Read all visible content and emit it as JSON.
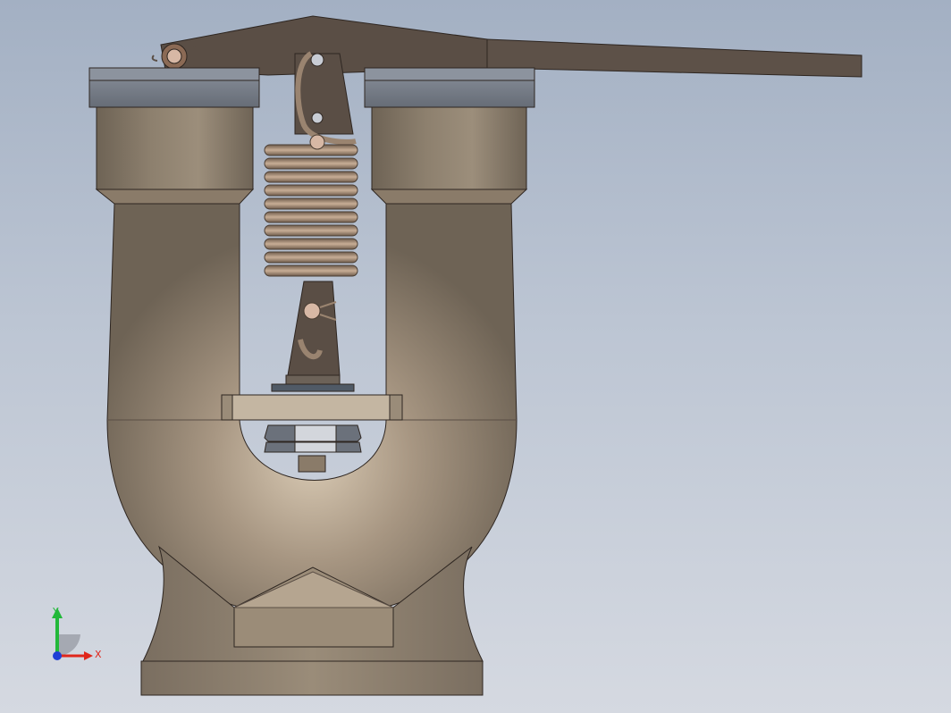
{
  "viewport": {
    "background_top": "#a3b0c3",
    "background_bottom": "#d5d9e1"
  },
  "model": {
    "name": "",
    "body_color": "#8a7b69",
    "lever_color": "#5a4e45",
    "cap_color": "#7b818c",
    "spring_color": "#9a8470"
  },
  "triad": {
    "x_label": "X",
    "y_label": "Y",
    "x_color": "#e0261b",
    "y_color": "#22b83a",
    "z_color": "#1f3fd6"
  }
}
